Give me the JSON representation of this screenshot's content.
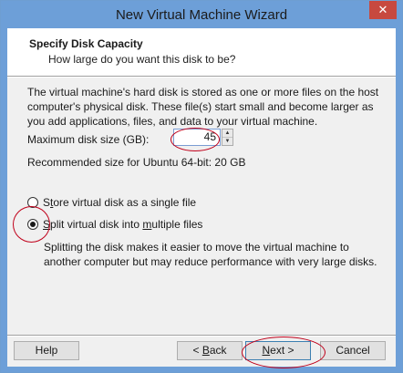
{
  "window": {
    "title": "New Virtual Machine Wizard",
    "close_glyph": "✕"
  },
  "header": {
    "title": "Specify Disk Capacity",
    "subtitle": "How large do you want this disk to be?"
  },
  "description": "The virtual machine's hard disk is stored as one or more files on the host computer's physical disk. These file(s) start small and become larger as you add applications, files, and data to your virtual machine.",
  "disk_size": {
    "label": "Maximum disk size (GB):",
    "value": "45",
    "recommended": "Recommended size for Ubuntu 64-bit: 20 GB"
  },
  "options": {
    "single": {
      "prefix": "S",
      "underlined": "t",
      "suffix": "ore virtual disk as a single file",
      "selected": false
    },
    "split": {
      "underlined1": "S",
      "middle": "plit virtual disk into ",
      "underlined2": "m",
      "suffix": "ultiple files",
      "selected": true,
      "description": "Splitting the disk makes it easier to move the virtual machine to another computer but may reduce performance with very large disks."
    }
  },
  "buttons": {
    "help": "Help",
    "back_prefix": "< ",
    "back_underlined": "B",
    "back_suffix": "ack",
    "next_underlined": "N",
    "next_suffix": "ext >",
    "cancel": "Cancel"
  },
  "colors": {
    "titlebar": "#6d9fd8",
    "annotation": "#c0001a"
  }
}
